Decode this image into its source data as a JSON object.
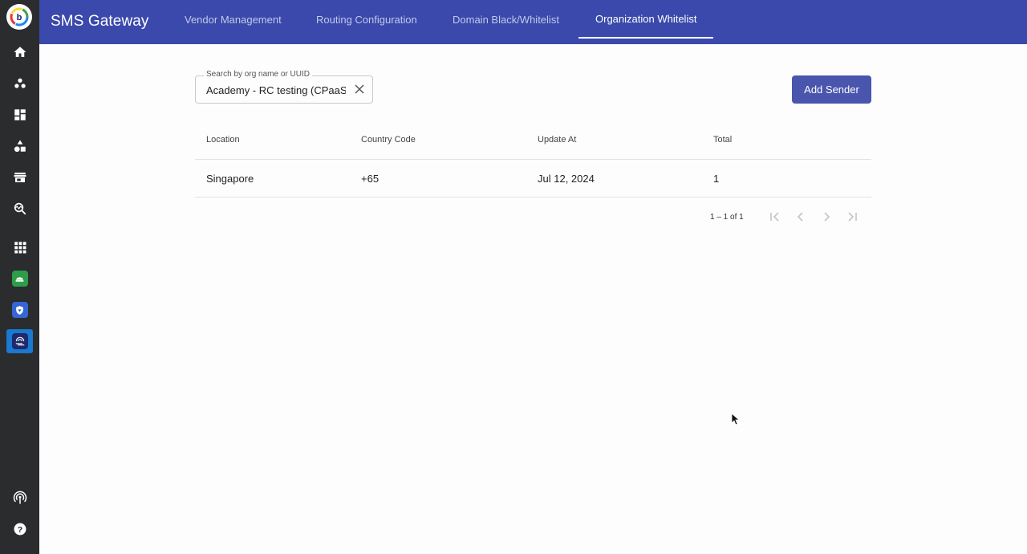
{
  "app": {
    "title": "SMS Gateway"
  },
  "tabs": [
    {
      "label": "Vendor Management",
      "active": false
    },
    {
      "label": "Routing Configuration",
      "active": false
    },
    {
      "label": "Domain Black/Whitelist",
      "active": false
    },
    {
      "label": "Organization Whitelist",
      "active": true
    }
  ],
  "sidebar": {
    "items": [
      {
        "icon": "home-icon"
      },
      {
        "icon": "people-icon"
      },
      {
        "icon": "dashboard-icon"
      },
      {
        "icon": "shapes-icon"
      },
      {
        "icon": "store-icon"
      },
      {
        "icon": "query-stats-icon"
      },
      {
        "icon": "apps-grid-icon"
      },
      {
        "icon": "green-app-icon"
      },
      {
        "icon": "blue-shield-app-icon"
      },
      {
        "icon": "sms-gateway-app-icon",
        "active": true
      },
      {
        "icon": "broadcast-icon"
      },
      {
        "icon": "help-icon"
      }
    ]
  },
  "search": {
    "label": "Search by org name or UUID",
    "value": "Academy - RC testing (CPaaS"
  },
  "add_button": {
    "label": "Add Sender"
  },
  "table": {
    "columns": [
      "Location",
      "Country Code",
      "Update At",
      "Total"
    ],
    "rows": [
      [
        "Singapore",
        "+65",
        "Jul 12, 2024",
        "1"
      ]
    ]
  },
  "pagination": {
    "range_text": "1 – 1 of 1"
  },
  "colors": {
    "topbar": "#3a49ab",
    "sidebar": "#2b2c2e",
    "primary_button": "#4a55ad",
    "active_sidebar": "#1a79d0"
  }
}
